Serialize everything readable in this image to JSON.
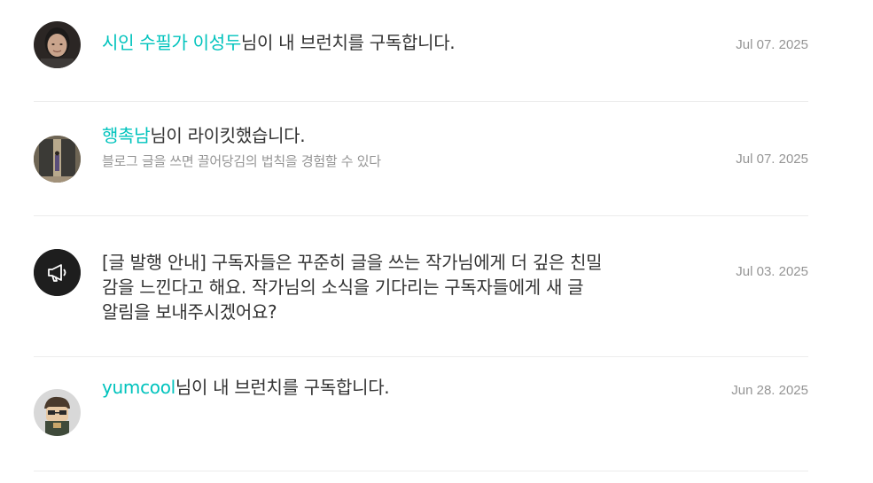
{
  "notifications": [
    {
      "name": "시인 수필가 이성두",
      "message": "님이 내 브런치를 구독합니다.",
      "subtext": "",
      "date": "Jul 07. 2025",
      "avatar": "user-photo"
    },
    {
      "name": "행촉남",
      "message": "님이 라이킷했습니다.",
      "subtext": "블로그 글을 쓰면 끌어당김의 법칙을 경험할 수 있다",
      "date": "Jul 07. 2025",
      "avatar": "user-photo"
    },
    {
      "notice": "[글 발행 안내] 구독자들은 꾸준히 글을 쓰는 작가님에게 더 깊은 친밀감을 느낀다고 해요. 작가님의 소식을 기다리는 구독자들에게 새 글 알림을 보내주시겠어요?",
      "date": "Jul 03. 2025",
      "avatar": "megaphone-icon"
    },
    {
      "name": "yumcool",
      "message": "님이 내 브런치를 구독합니다.",
      "subtext": "",
      "date": "Jun 28. 2025",
      "avatar": "user-photo"
    }
  ]
}
